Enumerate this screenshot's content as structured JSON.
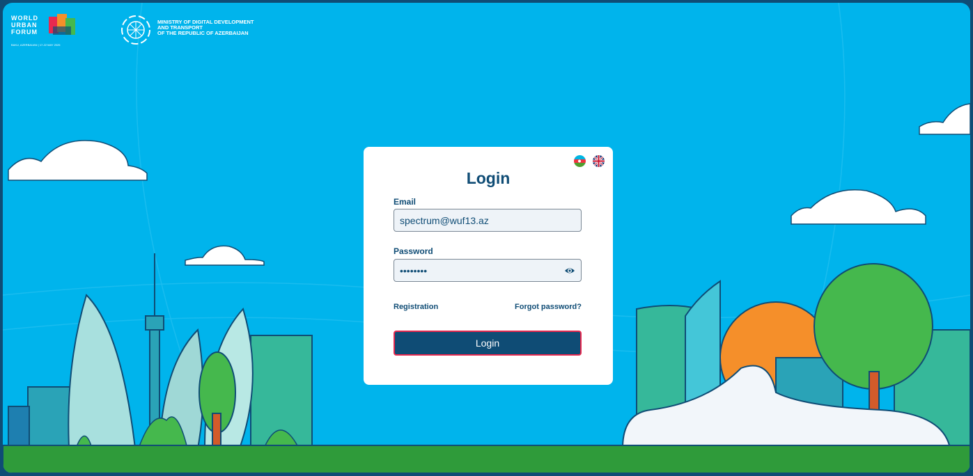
{
  "header": {
    "wuf_lines": [
      "WORLD",
      "URBAN",
      "FORUM"
    ],
    "wuf_tagline": "BAKU, AZERBAIJAN | 17-22 MAY 2026",
    "ministry_lines": [
      "MINISTRY OF DIGITAL DEVELOPMENT",
      "AND TRANSPORT",
      "OF THE REPUBLIC OF AZERBAIJAN"
    ]
  },
  "login": {
    "title": "Login",
    "languages": [
      {
        "code": "az",
        "icon": "azerbaijan-flag-icon"
      },
      {
        "code": "en",
        "icon": "uk-flag-icon"
      }
    ],
    "email_label": "Email",
    "email_value": "spectrum@wuf13.az",
    "password_label": "Password",
    "password_value": "••••••••",
    "show_password_icon": "eye-icon",
    "registration_link": "Registration",
    "forgot_link": "Forgot password?",
    "submit_label": "Login"
  },
  "colors": {
    "sky": "#00b4ec",
    "navy": "#0f4c75",
    "button_border": "#e8294f",
    "grass": "#2f9b3a"
  }
}
